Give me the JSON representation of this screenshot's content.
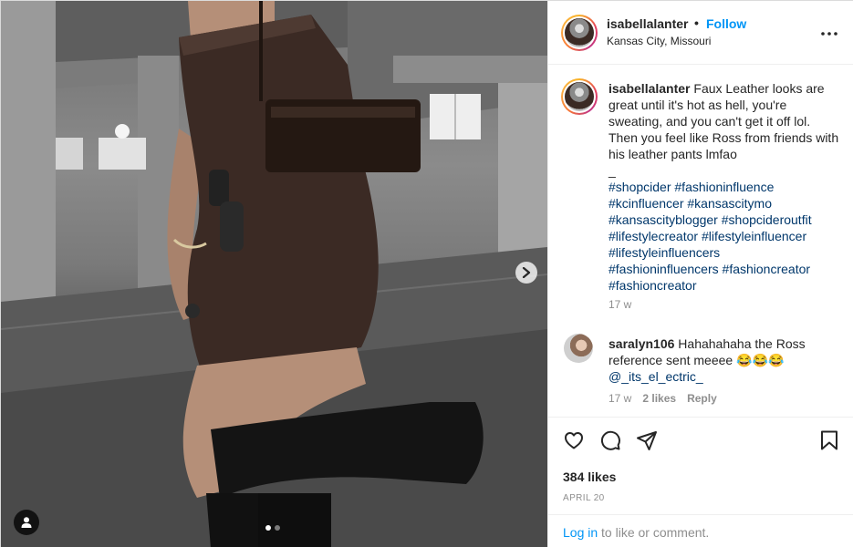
{
  "post": {
    "author": "isabellalanter",
    "separator": "•",
    "follow_label": "Follow",
    "location": "Kansas City, Missouri",
    "more_icon": "more-horizontal-icon"
  },
  "caption": {
    "username": "isabellalanter",
    "text": "Faux Leather looks are great until it's hot as hell, you're sweating, and you can't get it off lol. Then you feel like Ross from friends with his leather pants lmfao",
    "divider": "_",
    "hashtags": [
      "#shopcider",
      "#fashioninfluence",
      "#kcinfluencer",
      "#kansascitymo",
      "#kansascityblogger",
      "#shopcideroutfit",
      "#lifestylecreator",
      "#lifestyleinfluencer",
      "#lifestyleinfluencers",
      "#fashioninfluencers",
      "#fashioncreator",
      "#fashioncreator"
    ],
    "time": "17 w"
  },
  "comment": {
    "username": "saralyn106",
    "text": "Hahahahaha the Ross reference sent meeee 😂😂😂",
    "mention": "@_its_el_ectric_",
    "time": "17 w",
    "likes": "2 likes",
    "reply_label": "Reply"
  },
  "actions": {
    "icons": [
      "heart-icon",
      "comment-icon",
      "share-icon",
      "bookmark-icon"
    ]
  },
  "likes_label": "384 likes",
  "date_label": "APRIL 20",
  "footer": {
    "login_label": "Log in",
    "rest": " to like or comment."
  },
  "carousel": {
    "total_slides": 2,
    "active_slide": 1
  },
  "colors": {
    "link": "#0095f6",
    "hashtag": "#00376b",
    "muted": "#8e8e8e",
    "text": "#262626"
  }
}
